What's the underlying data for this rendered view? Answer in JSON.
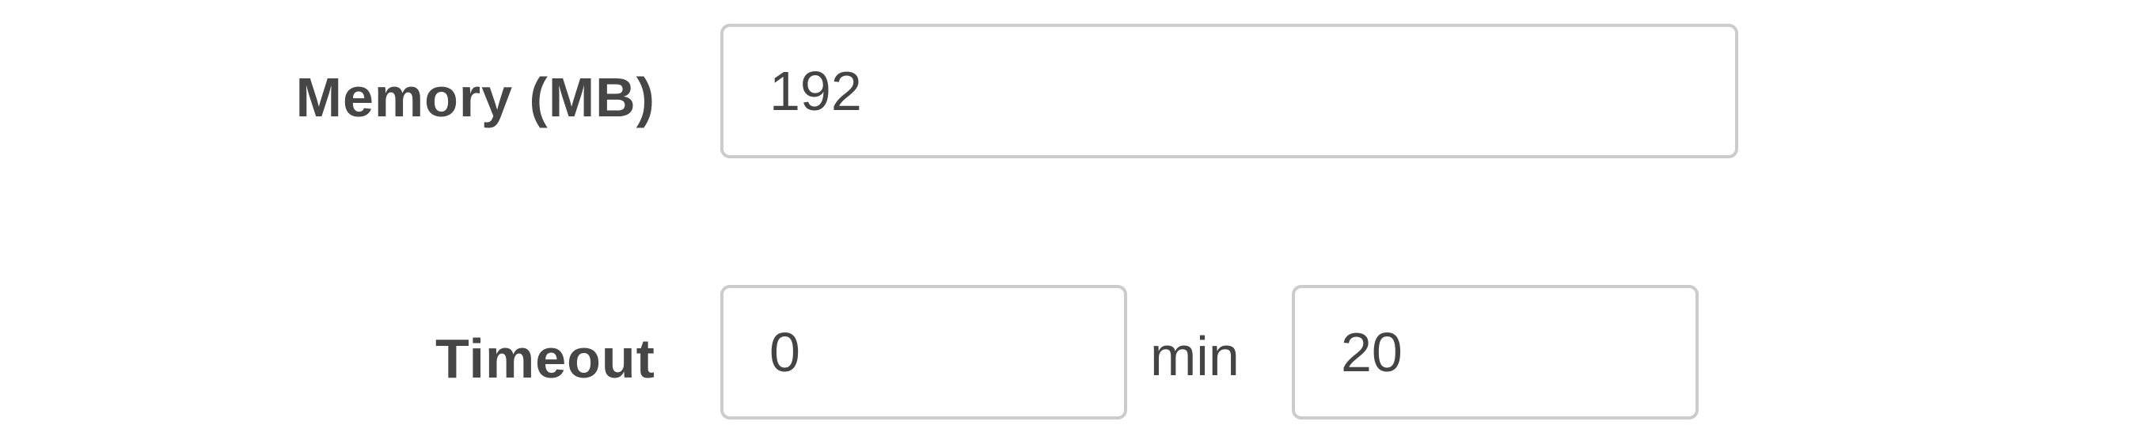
{
  "memory": {
    "label": "Memory (MB)",
    "value": "192"
  },
  "timeout": {
    "label": "Timeout",
    "minutes_value": "0",
    "minutes_unit": "min",
    "seconds_value": "20"
  }
}
